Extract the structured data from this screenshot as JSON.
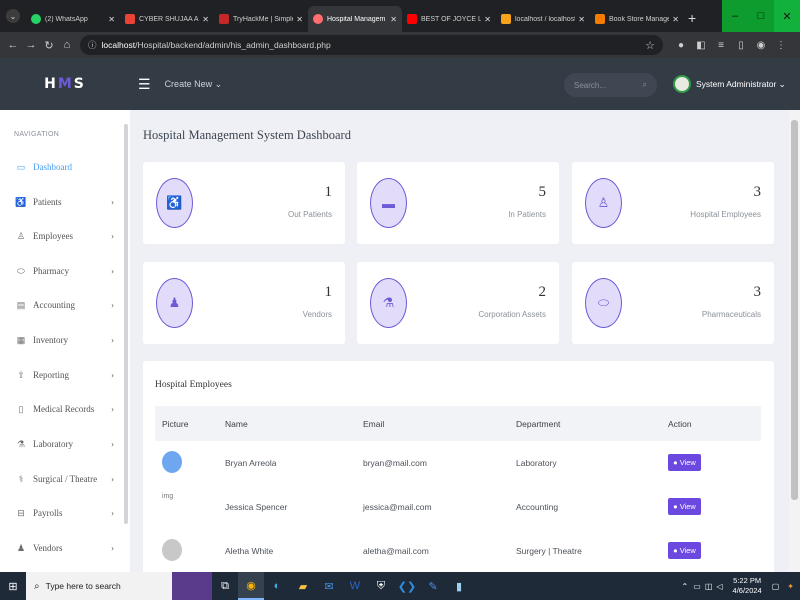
{
  "browser": {
    "tabs": [
      {
        "label": "(2) WhatsApp",
        "color": "#25d366",
        "active": false
      },
      {
        "label": "CYBER SHUJAA APP",
        "color": "#ea4335",
        "active": false
      },
      {
        "label": "TryHackMe | Simple",
        "color": "#c62828",
        "active": false
      },
      {
        "label": "Hospital Managem",
        "color": "#ff6d6d",
        "active": true
      },
      {
        "label": "BEST OF JOYCE LAN",
        "color": "#ff0000",
        "active": false
      },
      {
        "label": "localhost / localhost",
        "color": "#f6a21b",
        "active": false
      },
      {
        "label": "Book Store Manage",
        "color": "#f57c00",
        "active": false
      }
    ],
    "url_host": "localhost",
    "url_path": "/Hospital/backend/admin/his_admin_dashboard.php"
  },
  "header": {
    "logo_left": "H",
    "logo_mid": "M",
    "logo_right": "S",
    "create_new": "Create New ⌄",
    "search_placeholder": "Search...",
    "user_name": "System Administrator ⌄"
  },
  "sidebar": {
    "caption": "NAVIGATION",
    "items": [
      {
        "label": "Dashboard",
        "icon": "monitor-icon",
        "active": true
      },
      {
        "label": "Patients",
        "icon": "wheelchair-icon"
      },
      {
        "label": "Employees",
        "icon": "user-icon"
      },
      {
        "label": "Pharmacy",
        "icon": "pill-icon"
      },
      {
        "label": "Accounting",
        "icon": "money-icon"
      },
      {
        "label": "Inventory",
        "icon": "boxes-icon"
      },
      {
        "label": "Reporting",
        "icon": "upload-icon"
      },
      {
        "label": "Medical Records",
        "icon": "file-icon"
      },
      {
        "label": "Laboratory",
        "icon": "flask-icon"
      },
      {
        "label": "Surgical / Theatre",
        "icon": "surgeon-icon"
      },
      {
        "label": "Payrolls",
        "icon": "wallet-icon"
      },
      {
        "label": "Vendors",
        "icon": "users-icon"
      }
    ]
  },
  "main": {
    "title": "Hospital Management System Dashboard",
    "cards": [
      {
        "count": "1",
        "label": "Out Patients",
        "icon": "wheelchair-icon"
      },
      {
        "count": "5",
        "label": "In Patients",
        "icon": "bed-icon"
      },
      {
        "count": "3",
        "label": "Hospital Employees",
        "icon": "doctor-icon"
      },
      {
        "count": "1",
        "label": "Vendors",
        "icon": "vendor-icon"
      },
      {
        "count": "2",
        "label": "Corporation Assets",
        "icon": "flask-icon"
      },
      {
        "count": "3",
        "label": "Pharmaceuticals",
        "icon": "capsule-icon"
      }
    ],
    "employees": {
      "title": "Hospital Employees",
      "columns": [
        "Picture",
        "Name",
        "Email",
        "Department",
        "Action"
      ],
      "rows": [
        {
          "name": "Bryan Arreola",
          "email": "bryan@mail.com",
          "department": "Laboratory",
          "action": "View",
          "pic_alt": ""
        },
        {
          "name": "Jessica Spencer",
          "email": "jessica@mail.com",
          "department": "Accounting",
          "action": "View",
          "pic_alt": "img"
        },
        {
          "name": "Aletha White",
          "email": "aletha@mail.com",
          "department": "Surgery | Theatre",
          "action": "View",
          "pic_alt": ""
        }
      ]
    }
  },
  "taskbar": {
    "search_placeholder": "Type here to search",
    "time": "5:22 PM",
    "date": "4/6/2024"
  },
  "colors": {
    "accent": "#6b5bd6",
    "header_bg": "#333b45",
    "view_button": "#6b48e0",
    "active_nav": "#4a9ef0"
  }
}
